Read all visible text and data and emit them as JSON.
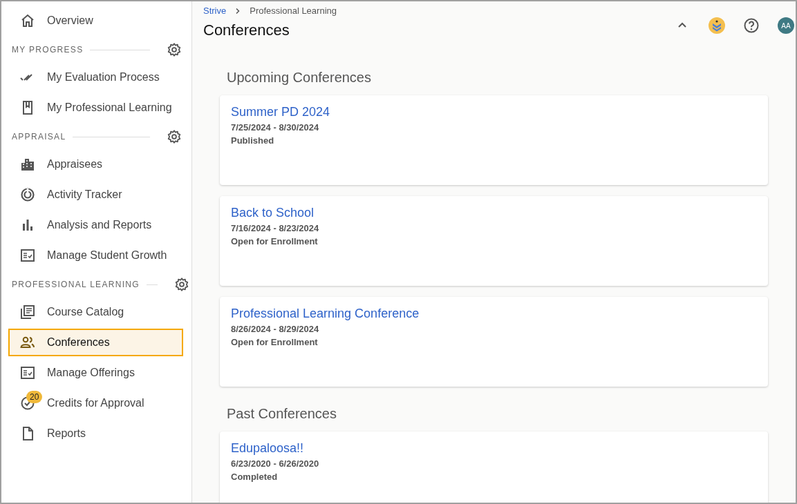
{
  "sidebar": {
    "top_item": {
      "label": "Overview",
      "selected": false
    },
    "sections": [
      {
        "title": "MY PROGRESS",
        "items": [
          {
            "label": "My Evaluation Process",
            "selected": false
          },
          {
            "label": "My Professional Learning",
            "selected": false
          }
        ]
      },
      {
        "title": "APPRAISAL",
        "items": [
          {
            "label": "Appraisees",
            "selected": false
          },
          {
            "label": "Activity Tracker",
            "selected": false
          },
          {
            "label": "Analysis and Reports",
            "selected": false
          },
          {
            "label": "Manage Student Growth",
            "selected": false
          }
        ]
      },
      {
        "title": "PROFESSIONAL LEARNING",
        "items": [
          {
            "label": "Course Catalog",
            "selected": false
          },
          {
            "label": "Conferences",
            "selected": true
          },
          {
            "label": "Manage Offerings",
            "selected": false
          },
          {
            "label": "Credits for Approval",
            "selected": false,
            "badge": "20"
          },
          {
            "label": "Reports",
            "selected": false
          }
        ]
      }
    ]
  },
  "breadcrumb": [
    "Strive",
    "Professional Learning"
  ],
  "page_title": "Conferences",
  "avatar": "AA",
  "groups": [
    {
      "title": "Upcoming Conferences",
      "cards": [
        {
          "name": "Summer PD 2024",
          "dates": "7/25/2024 - 8/30/2024",
          "status": "Published"
        },
        {
          "name": "Back to School",
          "dates": "7/16/2024 - 8/23/2024",
          "status": "Open for Enrollment"
        },
        {
          "name": "Professional Learning Conference",
          "dates": "8/26/2024 - 8/29/2024",
          "status": "Open for Enrollment"
        }
      ]
    },
    {
      "title": "Past Conferences",
      "cards": [
        {
          "name": "Edupaloosa!!",
          "dates": "6/23/2020 - 6/26/2020",
          "status": "Completed"
        }
      ]
    }
  ]
}
